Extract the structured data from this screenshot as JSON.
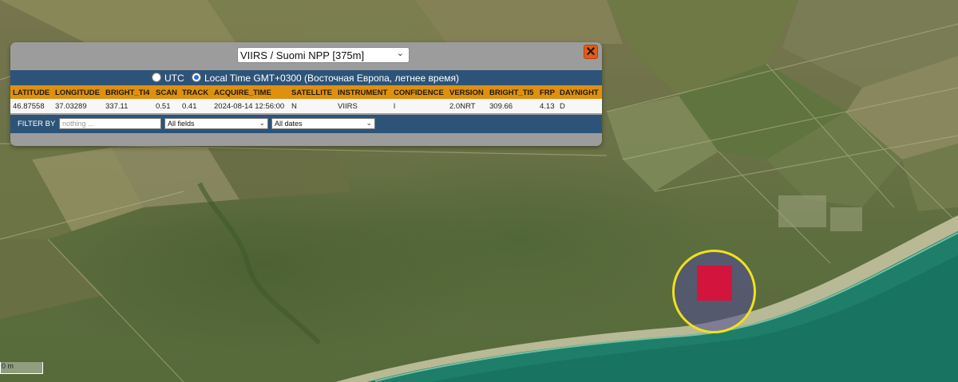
{
  "layer_select": {
    "value": "VIIRS / Suomi NPP [375m]"
  },
  "close_icon": "✕",
  "time": {
    "utc_label": "UTC",
    "local_label": "Local Time GMT+0300 (Восточная Европа, летнее время)",
    "selected": "local"
  },
  "table": {
    "headers": [
      "LATITUDE",
      "LONGITUDE",
      "BRIGHT_TI4",
      "SCAN",
      "TRACK",
      "ACQUIRE_TIME",
      "SATELLITE",
      "INSTRUMENT",
      "CONFIDENCE",
      "VERSION",
      "BRIGHT_TI5",
      "FRP",
      "DAYNIGHT"
    ],
    "row": [
      "46.87558",
      "37.03289",
      "337.11",
      "0.51",
      "0.41",
      "2024-08-14 12:56:00",
      "N",
      "VIIRS",
      "l",
      "2.0NRT",
      "309.66",
      "4.13",
      "D"
    ]
  },
  "filter": {
    "label": "FILTER BY",
    "placeholder": "nothing ...",
    "field_value": "All fields",
    "date_value": "All dates"
  },
  "map": {
    "marker_ring_color": "#efe21d",
    "marker_fill_color": "#d3143d",
    "scale_text": "0 m"
  },
  "colors": {
    "bar_blue": "#2d5478",
    "header_orange": "#e0900f",
    "close_orange": "#e35b16"
  }
}
